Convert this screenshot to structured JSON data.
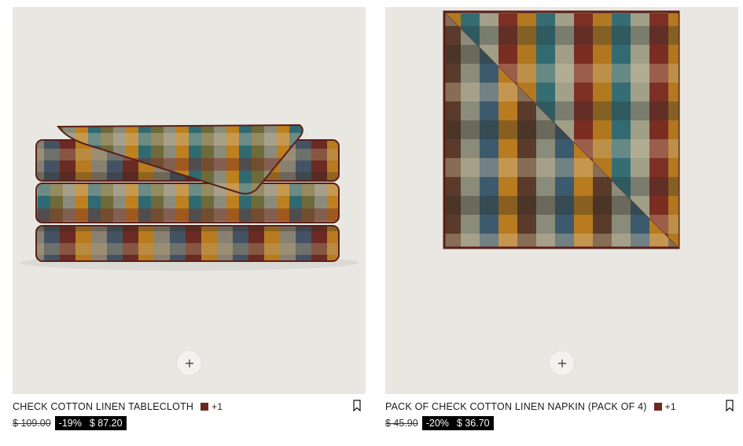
{
  "products": [
    {
      "name": "CHECK COTTON LINEN TABLECLOTH",
      "swatch_color": "#6b2b1c",
      "more_colors": "+1",
      "old_price": "$ 109.00",
      "discount": "-19%",
      "price": "$ 87.20",
      "quick_add_symbol": "+",
      "media_background": "#e9e7e2"
    },
    {
      "name": "PACK OF CHECK COTTON LINEN NAPKIN (PACK OF 4)",
      "swatch_color": "#6b2b1c",
      "more_colors": "+1",
      "old_price": "$ 45.90",
      "discount": "-20%",
      "price": "$ 36.70",
      "quick_add_symbol": "+",
      "media_background": "#e9e7e2"
    }
  ],
  "icons": {
    "quick_add": "plus-icon",
    "save": "bookmark-icon"
  },
  "plaid_palette": [
    "#7a2a22",
    "#c58a1e",
    "#3b5a6e",
    "#8a8b7a",
    "#5a3a2a",
    "#b9a67a",
    "#2f6a72",
    "#6e6a3a"
  ]
}
